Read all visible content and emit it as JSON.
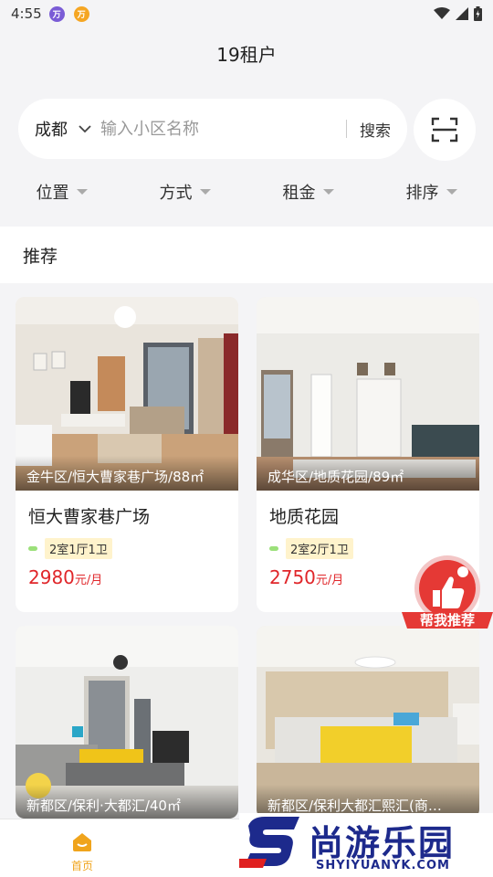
{
  "status_bar": {
    "time": "4:55",
    "app_badges": [
      "万",
      "万"
    ]
  },
  "app_title": "19租户",
  "search": {
    "city": "成都",
    "placeholder": "输入小区名称",
    "button_label": "搜索"
  },
  "filters": [
    {
      "label": "位置"
    },
    {
      "label": "方式"
    },
    {
      "label": "租金"
    },
    {
      "label": "排序"
    }
  ],
  "section_title": "推荐",
  "listings": [
    {
      "caption": "金牛区/恒大曹家巷广场/88㎡",
      "name": "恒大曹家巷广场",
      "tag": "2室1厅1卫",
      "price": "2980",
      "unit": "元/月"
    },
    {
      "caption": "成华区/地质花园/89㎡",
      "name": "地质花园",
      "tag": "2室2厅1卫",
      "price": "2750",
      "unit": "元/月"
    },
    {
      "caption": "新都区/保利·大都汇/40㎡"
    },
    {
      "caption": "新都区/保利大都汇熙汇(商…"
    }
  ],
  "float_button": {
    "label": "帮我推荐"
  },
  "tabbar": {
    "home_label": "首页"
  },
  "watermark": {
    "text": "尚游乐园",
    "url_text": "SHYIYUANYK.COM"
  },
  "colors": {
    "price": "#e0262a",
    "accent": "#f0a41c",
    "tag_bg": "#fff3cc",
    "float_button": "#e53935"
  }
}
